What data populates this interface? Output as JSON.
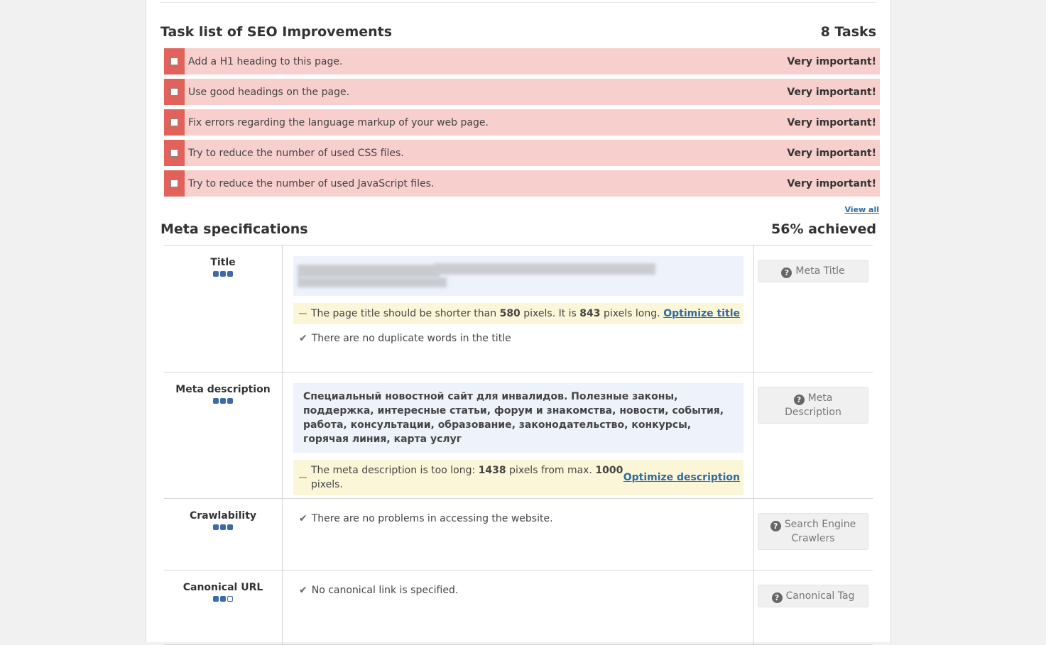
{
  "tasks_section": {
    "title": "Task list of SEO Improvements",
    "count": "8 Tasks",
    "items": [
      {
        "label": "Add a H1 heading to this page.",
        "priority": "Very important!"
      },
      {
        "label": "Use good headings on the page.",
        "priority": "Very important!"
      },
      {
        "label": "Fix errors regarding the language markup of your web page.",
        "priority": "Very important!"
      },
      {
        "label": "Try to reduce the number of used CSS files.",
        "priority": "Very important!"
      },
      {
        "label": "Try to reduce the number of used JavaScript files.",
        "priority": "Very important!"
      }
    ],
    "view_all": "View all"
  },
  "meta_section": {
    "title": "Meta specifications",
    "achieved": "56% achieved",
    "rows": {
      "title": {
        "name": "Title",
        "importance": 3,
        "warning": {
          "pre": "The page title should be shorter than ",
          "v1": "580",
          "mid": " pixels. It is ",
          "v2": "843",
          "post": " pixels long.",
          "link": "Optimize title"
        },
        "ok": "There are no duplicate words in the title",
        "help": "Meta Title"
      },
      "description": {
        "name": "Meta description",
        "importance": 3,
        "content": "Специальный новостной сайт для инвалидов. Полезные законы, поддержка, интересные статьи, форум и знакомства, новости, события, работа, консультации, образование, законодательство, конкурсы, горячая линия, карта услуг",
        "warning": {
          "pre": "The meta description is too long: ",
          "v1": "1438",
          "mid": " pixels from max. ",
          "v2": "1000",
          "post": " pixels.",
          "link": "Optimize description"
        },
        "help": "Meta Description"
      },
      "crawlability": {
        "name": "Crawlability",
        "importance": 3,
        "ok": "There are no problems in accessing the website.",
        "help": "Search Engine Crawlers"
      },
      "canonical": {
        "name": "Canonical URL",
        "importance": 2,
        "ok": "No canonical link is specified.",
        "help": "Canonical Tag"
      }
    }
  }
}
